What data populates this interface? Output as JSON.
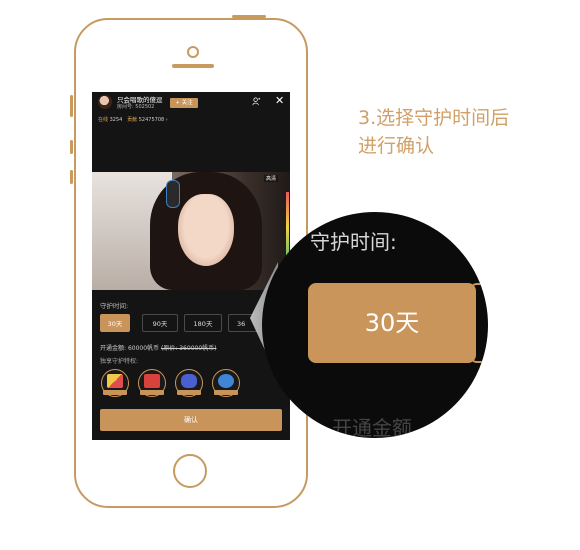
{
  "anchor": {
    "name": "只会唱歌的傻逗",
    "room_label": "房间号:",
    "room_id": "502502",
    "follow_label": "+ 关注"
  },
  "stats": {
    "online_label": "在线",
    "online_count": "3254",
    "contribution_label": "贡献",
    "contribution_value": "52475708",
    "chevron": "›"
  },
  "video": {
    "badge": "高清"
  },
  "guard": {
    "title": "守护时间:",
    "options": [
      "30天",
      "90天",
      "180天",
      "36"
    ],
    "selected_index": 0,
    "price_label": "开通金额:",
    "price_value": "60000帆币",
    "original_price": "(原价: 360000帆币)",
    "privileges_title": "独享守护特权:",
    "privilege_icons": [
      "vip-badge-icon",
      "gift-badge-icon",
      "chat-badge-icon",
      "no-kick-badge-icon"
    ],
    "confirm_label": "确认"
  },
  "callout": {
    "line1": "3.选择守护时间后",
    "line2": "进行确认"
  },
  "zoom": {
    "title": "守护时间:",
    "option": "30天",
    "fade_text": "开通金额"
  },
  "colors": {
    "accent": "#c8945a",
    "frame": "#c79a60",
    "callout": "#d0a068",
    "screen_bg": "#141414"
  }
}
